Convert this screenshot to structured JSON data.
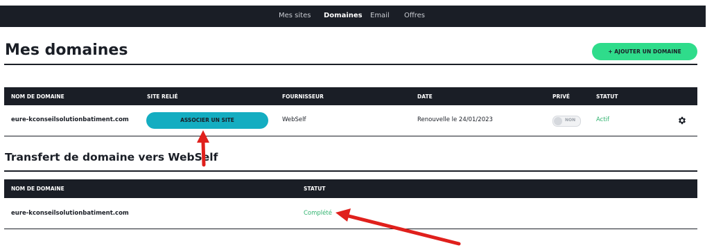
{
  "nav": {
    "items": [
      {
        "label": "Mes sites",
        "active": false
      },
      {
        "label": "Domaines",
        "active": true
      },
      {
        "label": "Email",
        "active": false
      },
      {
        "label": "Offres",
        "active": false
      }
    ]
  },
  "page": {
    "title": "Mes domaines",
    "add_button": "+ AJOUTER UN DOMAINE"
  },
  "domains_table": {
    "headers": {
      "domain": "NOM DE DOMAINE",
      "site": "SITE RELIÉ",
      "provider": "FOURNISSEUR",
      "date": "DATE",
      "private": "PRIVÉ",
      "status": "STATUT"
    },
    "rows": [
      {
        "domain": "eure-kconseilsolutionbatiment.com",
        "site_button": "ASSOCIER UN SITE",
        "provider": "WebSelf",
        "date": "Renouvelle le 24/01/2023",
        "private_toggle": "NON",
        "status": "Actif"
      }
    ]
  },
  "transfer": {
    "title": "Transfert de domaine vers WebSelf",
    "headers": {
      "domain": "NOM DE DOMAINE",
      "status": "STATUT"
    },
    "rows": [
      {
        "domain": "eure-kconseilsolutionbatiment.com",
        "status": "Complété"
      }
    ]
  },
  "colors": {
    "dark": "#1a1e26",
    "accent_green": "#2fdc8b",
    "accent_teal": "#14adc1",
    "status_green": "#2fb36e",
    "annotation_red": "#e0201c"
  },
  "icons": {
    "settings": "gear-icon"
  }
}
